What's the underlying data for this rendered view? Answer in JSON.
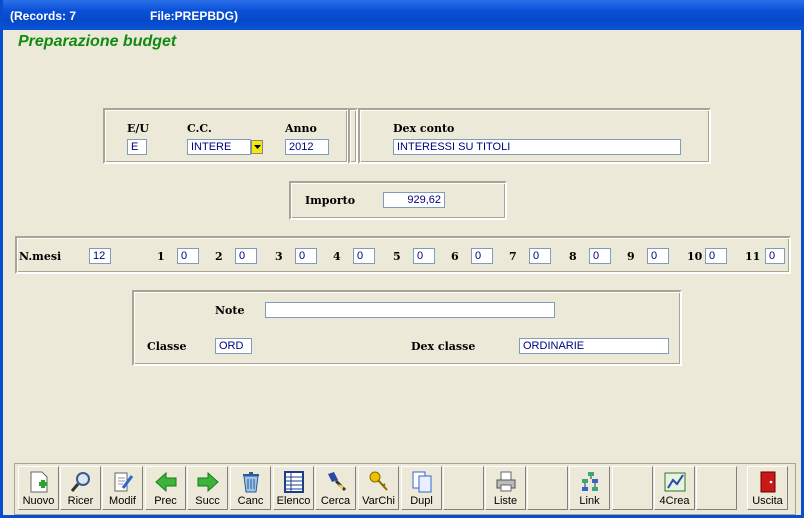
{
  "window": {
    "records": "(Records: 7",
    "file": "File:PREPBDG)"
  },
  "heading": "Preparazione budget",
  "account": {
    "eu_label": "E/U",
    "eu_value": "E",
    "cc_label": "C.C.",
    "cc_value": "INTERE",
    "anno_label": "Anno",
    "anno_value": "2012",
    "dex_conto_label": "Dex conto",
    "dex_conto_value": "INTERESSI SU TITOLI"
  },
  "importo": {
    "label": "Importo",
    "value": "929,62"
  },
  "months": {
    "label": "N.mesi",
    "count": "12",
    "items": [
      {
        "n": "1",
        "v": "0"
      },
      {
        "n": "2",
        "v": "0"
      },
      {
        "n": "3",
        "v": "0"
      },
      {
        "n": "4",
        "v": "0"
      },
      {
        "n": "5",
        "v": "0"
      },
      {
        "n": "6",
        "v": "0"
      },
      {
        "n": "7",
        "v": "0"
      },
      {
        "n": "8",
        "v": "0"
      },
      {
        "n": "9",
        "v": "0"
      },
      {
        "n": "10",
        "v": "0"
      },
      {
        "n": "11",
        "v": "0"
      }
    ]
  },
  "notes": {
    "note_label": "Note",
    "note_value": "",
    "classe_label": "Classe",
    "classe_value": "ORD",
    "dex_classe_label": "Dex classe",
    "dex_classe_value": "ORDINARIE"
  },
  "toolbar": {
    "nuovo": "Nuovo",
    "ricer": "Ricer",
    "modif": "Modif",
    "prec": "Prec",
    "succ": "Succ",
    "canc": "Canc",
    "elenco": "Elenco",
    "cerca": "Cerca",
    "varchi": "VarChi",
    "dupl": "Dupl",
    "liste": "Liste",
    "link": "Link",
    "crea4": "4Crea",
    "uscita": "Uscita"
  }
}
